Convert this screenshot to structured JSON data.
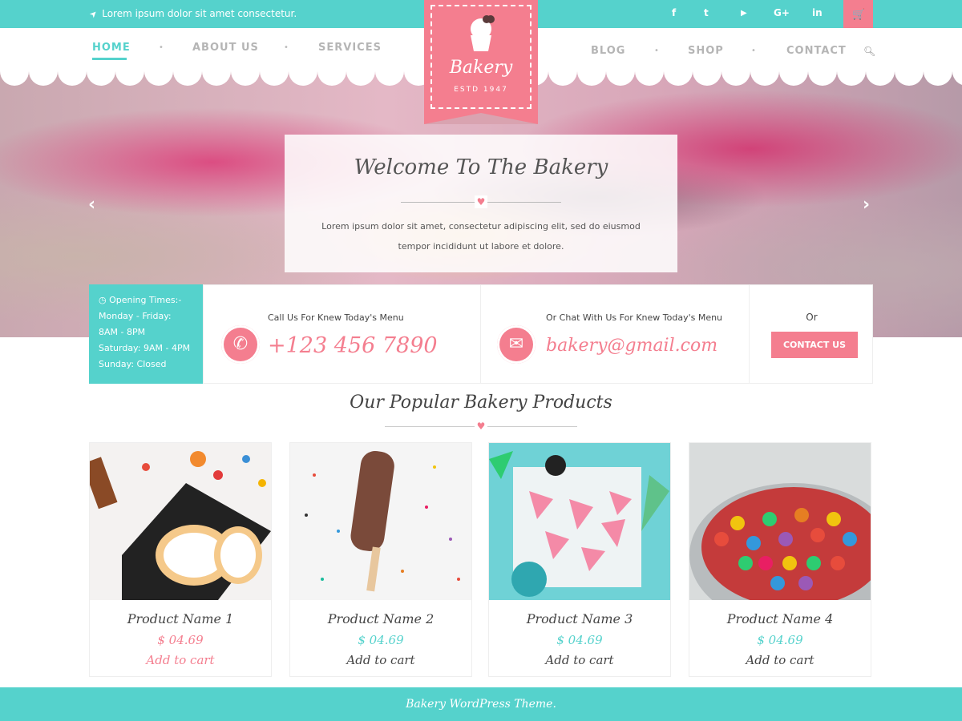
{
  "topbar": {
    "note": "Lorem ipsum dolor sit amet consectetur.",
    "social": [
      {
        "icon": "facebook-icon",
        "glyph": "f"
      },
      {
        "icon": "twitter-icon",
        "glyph": "t"
      },
      {
        "icon": "youtube-icon",
        "glyph": "▶"
      },
      {
        "icon": "google-plus-icon",
        "glyph": "G+"
      },
      {
        "icon": "linkedin-icon",
        "glyph": "in"
      }
    ],
    "cart_icon": "shopping-cart-icon"
  },
  "nav": {
    "left": [
      "HOME",
      "ABOUT US",
      "SERVICES"
    ],
    "right": [
      "BLOG",
      "SHOP",
      "CONTACT"
    ],
    "active": "HOME"
  },
  "logo": {
    "title": "Bakery",
    "estd": "ESTD    1947"
  },
  "hero": {
    "heading": "Welcome To The Bakery",
    "text": "Lorem ipsum dolor sit amet, consectetur adipiscing elit, sed do eiusmod tempor incididunt ut labore et dolore."
  },
  "hours": {
    "title": "Opening Times:-",
    "lines": [
      "Monday - Friday:",
      "8AM - 8PM",
      "Saturday: 9AM - 4PM",
      "Sunday: Closed"
    ]
  },
  "call": {
    "label": "Call Us For Knew Today's Menu",
    "value": "+123 456 7890"
  },
  "chat": {
    "label": "Or Chat With Us For Knew Today's Menu",
    "value": "bakery@gmail.com"
  },
  "contact": {
    "or": "Or",
    "button": "CONTACT US"
  },
  "products_section": {
    "title": "Our Popular Bakery Products"
  },
  "products": [
    {
      "name": "Product Name 1",
      "price": "$ 04.69",
      "cart": "Add to cart"
    },
    {
      "name": "Product Name 2",
      "price": "$ 04.69",
      "cart": "Add to cart"
    },
    {
      "name": "Product Name 3",
      "price": "$ 04.69",
      "cart": "Add to cart"
    },
    {
      "name": "Product Name 4",
      "price": "$ 04.69",
      "cart": "Add to cart"
    }
  ],
  "footer": {
    "text": "Bakery WordPress Theme."
  },
  "colors": {
    "teal": "#55d2cc",
    "pink": "#f47e8f"
  }
}
